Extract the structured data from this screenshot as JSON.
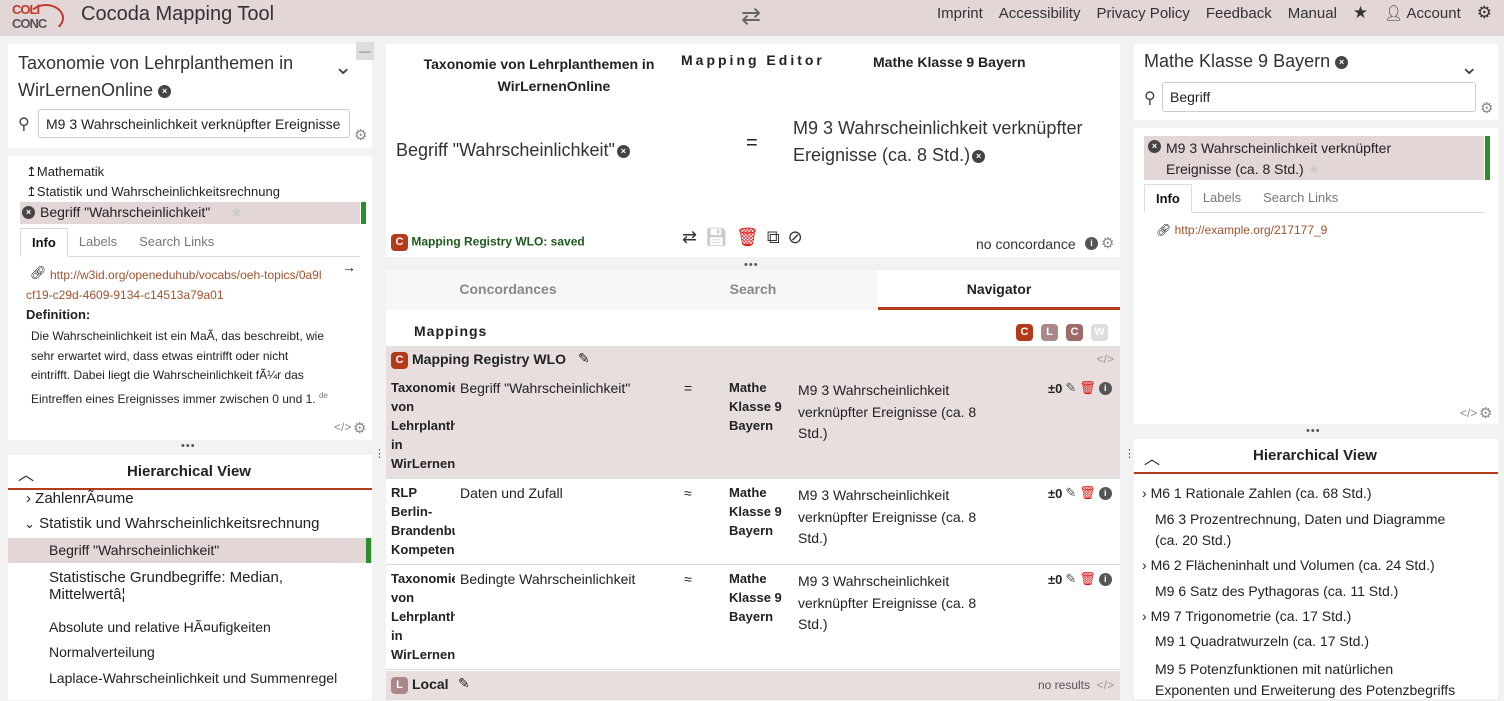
{
  "app": {
    "logo_top": "COLi",
    "logo_bottom": "CONC",
    "title": "Cocoda Mapping Tool"
  },
  "nav": {
    "imprint": "Imprint",
    "accessibility": "Accessibility",
    "privacy": "Privacy Policy",
    "feedback": "Feedback",
    "manual": "Manual",
    "account": "Account"
  },
  "left": {
    "scheme_title": "Taxonomie von Lehrplanthemen in WirLernenOnline",
    "search_value": "M9 3 Wahrscheinlichkeit verknüpfter Ereignisse",
    "ancestors": [
      "Mathematik",
      "Statistik und Wahrscheinlichkeitsrechnung"
    ],
    "selected": "Begriff \"Wahrscheinlichkeit\"",
    "tabs": [
      "Info",
      "Labels",
      "Search Links"
    ],
    "uri": "http://w3id.org/openeduhub/vocabs/oeh-topics/0a9bcf19-c29d-4609-9134-c14513a79a01",
    "uri_line1": "http://w3id.org/openeduhub/vocabs/oeh-topics/0a9l",
    "uri_line2": "cf19-c29d-4609-9134-c14513a79a01",
    "definition_label": "Definition:",
    "definition_lines": [
      "Die Wahrscheinlichkeit ist ein MaÃ, das beschreibt, wie",
      "sehr erwartet wird, dass etwas eintrifft oder nicht",
      "eintrifft. Dabei liegt die Wahrscheinlichkeit fÃ¼r das",
      "Eintreffen eines Ereignisses immer zwischen 0 und 1."
    ],
    "definition_lang": "de",
    "hv_title": "Hierarchical View",
    "hv_items": [
      {
        "label": "ZahlenrÃ¤ume",
        "arrow": "›"
      },
      {
        "label": "Statistik und Wahrscheinlichkeitsrechnung",
        "arrow": "⌄"
      },
      {
        "label": "Begriff \"Wahrscheinlichkeit\"",
        "arrow": ""
      },
      {
        "label": "Statistische Grundbegriffe: Median,",
        "label2": "Mittelwertâ¦",
        "arrow": ""
      },
      {
        "label": "Absolute und relative HÃ¤ufigkeiten",
        "arrow": ""
      },
      {
        "label": "Normalverteilung",
        "arrow": ""
      },
      {
        "label": "Laplace-Wahrscheinlichkeit und Summenregel",
        "arrow": ""
      }
    ]
  },
  "editor": {
    "left_scheme_line1": "Taxonomie von Lehrplanthemen in",
    "left_scheme_line2": "WirLernenOnline",
    "title": "Mapping Editor",
    "right_scheme": "Mathe Klasse 9 Bayern",
    "source_concept": "Begriff \"Wahrscheinlichkeit\"",
    "relation": "=",
    "target_line1": "M9 3 Wahrscheinlichkeit verknüpfter",
    "target_line2": "Ereignisse (ca. 8 Std.)",
    "registry_badge": "C",
    "registry_status": "Mapping Registry WLO: saved",
    "concordance": "no concordance"
  },
  "center_tabs": [
    "Concordances",
    "Search",
    "Navigator"
  ],
  "mappings": {
    "title": "Mappings",
    "badges": [
      "C",
      "L",
      "C",
      "W"
    ],
    "registry_name": "Mapping Registry WLO",
    "rows": [
      {
        "from_scheme": [
          "Taxonomie",
          "von",
          "Lehrplanth",
          "in",
          "WirLernen"
        ],
        "from": "Begriff \"Wahrscheinlichkeit\"",
        "rel": "=",
        "to_scheme": [
          "Mathe",
          "Klasse 9",
          "Bayern"
        ],
        "to": [
          "M9 3 Wahrscheinlichkeit",
          "verknüpfter Ereignisse (ca. 8",
          "Std.)"
        ],
        "score": "±0"
      },
      {
        "from_scheme": [
          "RLP",
          "Berlin-",
          "Brandenbu",
          "Kompeten"
        ],
        "from": "Daten und Zufall",
        "rel": "≈",
        "to_scheme": [
          "Mathe",
          "Klasse 9",
          "Bayern"
        ],
        "to": [
          "M9 3 Wahrscheinlichkeit",
          "verknüpfter Ereignisse (ca. 8",
          "Std.)"
        ],
        "score": "±0"
      },
      {
        "from_scheme": [
          "Taxonomie",
          "von",
          "Lehrplanth",
          "in",
          "WirLernen"
        ],
        "from": "Bedingte Wahrscheinlichkeit",
        "rel": "≈",
        "to_scheme": [
          "Mathe",
          "Klasse 9",
          "Bayern"
        ],
        "to": [
          "M9 3 Wahrscheinlichkeit",
          "verknüpfter Ereignisse (ca. 8",
          "Std.)"
        ],
        "score": "±0"
      }
    ],
    "local_badge": "L",
    "local_name": "Local",
    "local_status": "no results"
  },
  "right": {
    "scheme_title": "Mathe Klasse 9 Bayern",
    "search_value": "Begriff",
    "selected_line1": "M9 3 Wahrscheinlichkeit verknüpfter",
    "selected_line2": "Ereignisse (ca. 8 Std.)",
    "tabs": [
      "Info",
      "Labels",
      "Search Links"
    ],
    "uri": "http://example.org/217177_9",
    "hv_title": "Hierarchical View",
    "hv_items": [
      {
        "line1": "M6 1 Rationale Zahlen (ca. 68 Std.)",
        "arrow": "›"
      },
      {
        "line1": "M6 3 Prozentrechnung, Daten und Diagramme",
        "line2": "(ca. 20 Std.)",
        "arrow": ""
      },
      {
        "line1": "M6 2 Flächeninhalt und Volumen (ca. 24 Std.)",
        "arrow": "›"
      },
      {
        "line1": "M9 6 Satz des Pythagoras (ca. 11 Std.)",
        "arrow": ""
      },
      {
        "line1": "M9 7 Trigonometrie (ca. 17 Std.)",
        "arrow": "›"
      },
      {
        "line1": "M9 1 Quadratwurzeln (ca. 17 Std.)",
        "arrow": ""
      },
      {
        "line1": "M9 5 Potenzfunktionen mit natürlichen",
        "line2": "Exponenten und Erweiterung des Potenzbegriffs",
        "arrow": ""
      }
    ]
  }
}
